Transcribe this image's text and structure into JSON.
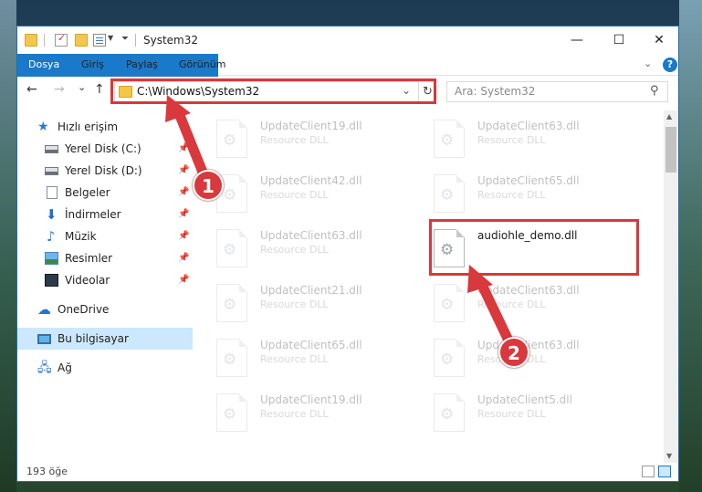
{
  "window": {
    "title": "System32",
    "buttons": {
      "minimize": "—",
      "maximize": "☐",
      "close": "✕"
    }
  },
  "ribbon": {
    "tabs": [
      "Dosya",
      "Giriş",
      "Paylaş",
      "Görünüm"
    ],
    "help": "?"
  },
  "nav": {
    "back": "←",
    "forward": "→",
    "recent": "⌄",
    "up": "↑",
    "address": "C:\\Windows\\System32",
    "address_dropdown": "⌄",
    "refresh": "↻",
    "search_placeholder": "Ara: System32",
    "search_icon": "⚲"
  },
  "sidebar": {
    "items": [
      {
        "label": "Hızlı erişim",
        "icon": "star-icon"
      },
      {
        "label": "Yerel Disk (C:)",
        "icon": "disk-icon",
        "pinned": true
      },
      {
        "label": "Yerel Disk (D:)",
        "icon": "disk-icon",
        "pinned": true
      },
      {
        "label": "Belgeler",
        "icon": "document-icon",
        "pinned": true
      },
      {
        "label": "İndirmeler",
        "icon": "download-icon",
        "pinned": true
      },
      {
        "label": "Müzik",
        "icon": "music-icon",
        "pinned": true
      },
      {
        "label": "Resimler",
        "icon": "pictures-icon",
        "pinned": true
      },
      {
        "label": "Videolar",
        "icon": "videos-icon",
        "pinned": true
      },
      {
        "label": "OneDrive",
        "icon": "cloud-icon"
      },
      {
        "label": "Bu bilgisayar",
        "icon": "computer-icon",
        "selected": true
      },
      {
        "label": "Ağ",
        "icon": "network-icon"
      }
    ],
    "pin_glyph": "📌"
  },
  "files": {
    "left": [
      {
        "name": "UpdateClient19.dll",
        "type": "Resource DLL"
      },
      {
        "name": "UpdateClient42.dll",
        "type": "Resource DLL"
      },
      {
        "name": "UpdateClient63.dll",
        "type": "Resource DLL"
      },
      {
        "name": "UpdateClient21.dll",
        "type": "Resource DLL"
      },
      {
        "name": "UpdateClient65.dll",
        "type": "Resource DLL"
      },
      {
        "name": "UpdateClient19.dll",
        "type": "Resource DLL"
      }
    ],
    "right": [
      {
        "name": "UpdateClient63.dll",
        "type": "Resource DLL"
      },
      {
        "name": "UpdateClient65.dll",
        "type": "Resource DLL"
      },
      {
        "name": "audiohle_demo.dll",
        "type": "",
        "highlighted": true
      },
      {
        "name": "UpdateClient63.dll",
        "type": "Resource DLL"
      },
      {
        "name": "UpdateClient63.dll",
        "type": "Resource DLL"
      },
      {
        "name": "UpdateClient5.dll",
        "type": "Resource DLL"
      }
    ]
  },
  "annotations": {
    "step1": "1",
    "step2": "2",
    "color": "#d9383c"
  },
  "status": {
    "count": "193 öğe"
  }
}
